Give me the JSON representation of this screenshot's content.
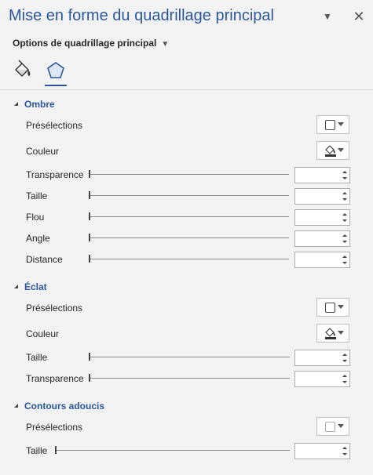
{
  "panel": {
    "title": "Mise en forme du quadrillage principal",
    "options_label": "Options de quadrillage principal"
  },
  "icons": {
    "dropdown": "chevron-down-icon",
    "close": "close-icon",
    "fill": "paint-bucket-icon",
    "effects": "pentagon-effects-icon",
    "color": "paint-bucket-color-icon"
  },
  "colors": {
    "accent": "#2b579a"
  },
  "sections": {
    "shadow": {
      "title": "Ombre",
      "presets": "Présélections",
      "color": "Couleur",
      "transparency": "Transparence",
      "size": "Taille",
      "blur": "Flou",
      "angle": "Angle",
      "distance": "Distance"
    },
    "glow": {
      "title": "Éclat",
      "presets": "Présélections",
      "color": "Couleur",
      "size": "Taille",
      "transparency": "Transparence"
    },
    "soft_edges": {
      "title": "Contours adoucis",
      "presets": "Présélections",
      "size": "Taille"
    }
  }
}
